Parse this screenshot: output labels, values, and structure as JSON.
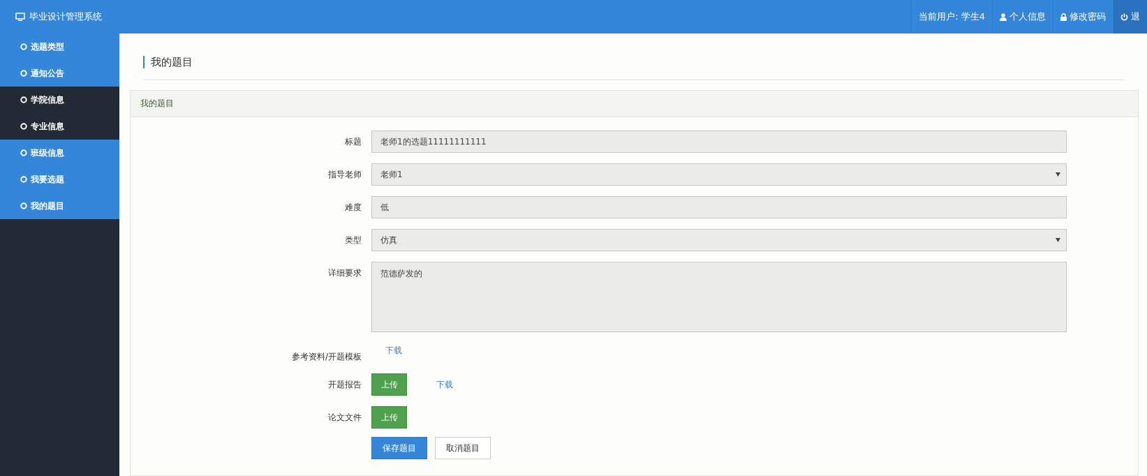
{
  "brand": {
    "title": "毕业设计管理系统"
  },
  "sidebar": {
    "items": [
      {
        "label": "选题类型",
        "selected": false
      },
      {
        "label": "通知公告",
        "selected": false
      },
      {
        "label": "学院信息",
        "selected": true
      },
      {
        "label": "专业信息",
        "selected": true
      },
      {
        "label": "班级信息",
        "selected": false
      },
      {
        "label": "我要选题",
        "selected": false
      },
      {
        "label": "我的题目",
        "selected": false
      }
    ]
  },
  "topbar": {
    "items": [
      {
        "kind": "user",
        "label": "当前用户: 学生4",
        "selected": false
      },
      {
        "kind": "profile",
        "label": "个人信息",
        "selected": false
      },
      {
        "kind": "password",
        "label": "修改密码",
        "selected": false
      },
      {
        "kind": "logout",
        "label": "退",
        "selected": true
      }
    ]
  },
  "page_title": "我的题目",
  "panel": {
    "title": "我的题目",
    "rows": [
      {
        "kind": "input",
        "label": "标题",
        "value": "老师1的选题11111111111",
        "disabled": true
      },
      {
        "kind": "select",
        "label": "指导老师",
        "value": "老师1",
        "disabled": true
      },
      {
        "kind": "input",
        "label": "难度",
        "value": "低",
        "disabled": true
      },
      {
        "kind": "select",
        "label": "类型",
        "value": "仿真",
        "disabled": true
      },
      {
        "kind": "textarea",
        "label": "详细要求",
        "value": "范德萨发的",
        "disabled": true
      },
      {
        "kind": "files",
        "label": "参考资料/开题模板",
        "actions": [
          {
            "kind": "link",
            "text": "下载"
          }
        ]
      },
      {
        "kind": "files",
        "label": "开题报告",
        "actions": [
          {
            "kind": "upload",
            "text": "上传"
          },
          {
            "kind": "link",
            "text": "下载"
          }
        ]
      },
      {
        "kind": "files",
        "label": "论文文件",
        "actions": [
          {
            "kind": "upload",
            "text": "上传"
          }
        ]
      }
    ],
    "buttons": [
      {
        "kind": "primary",
        "text": "保存题目"
      },
      {
        "kind": "default",
        "text": "取消题目"
      }
    ]
  }
}
